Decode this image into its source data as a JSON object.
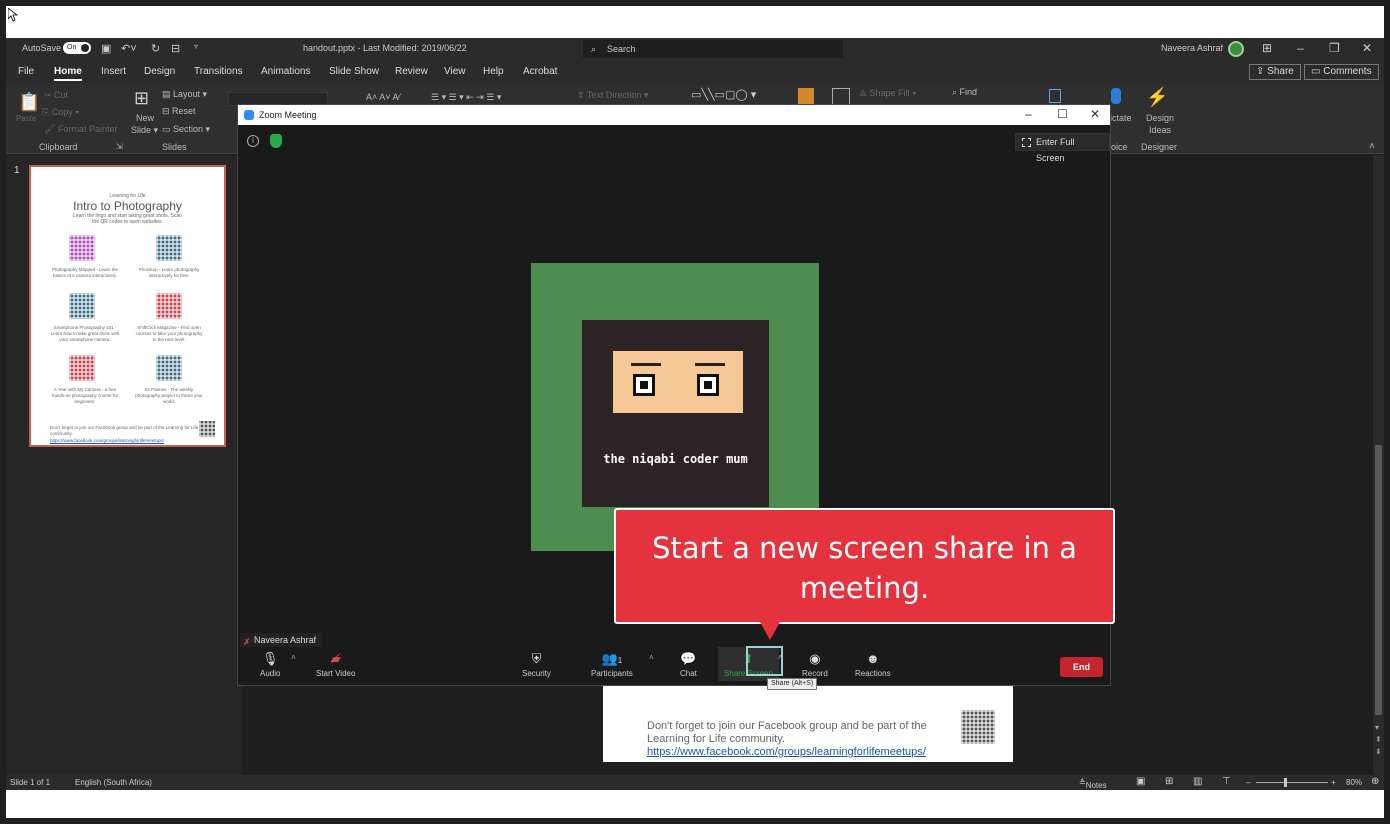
{
  "app": {
    "autosave_label": "AutoSave",
    "autosave_state": "On",
    "doc_title": "handout.pptx  -  Last Modified: 2019/06/22",
    "search_label": "Search",
    "user_name": "Naveera Ashraf"
  },
  "ribbon_tabs": [
    "File",
    "Home",
    "Insert",
    "Design",
    "Transitions",
    "Animations",
    "Slide Show",
    "Review",
    "View",
    "Help",
    "Acrobat"
  ],
  "ribbon_actions": {
    "share": "Share",
    "comments": "Comments"
  },
  "ribbon": {
    "paste": "Paste",
    "cut": "Cut",
    "copy": "Copy",
    "format_painter": "Format Painter",
    "clipboard_group": "Clipboard",
    "new_slide": "New",
    "new_slide_2": "Slide",
    "layout": "Layout",
    "reset": "Reset",
    "section": "Section",
    "slides_group": "Slides",
    "text_direction": "Text Direction",
    "shape_fill": "Shape Fill",
    "find": "Find",
    "dictate": "ictate",
    "voice_group": "oice",
    "design_ideas": "Design",
    "design_ideas_2": "Ideas",
    "designer_group": "Designer"
  },
  "thumbnail": {
    "slide_number": "1",
    "header_small": "Learning for Life",
    "header_big": "Intro to Photography",
    "subtitle": "Learn the lingo and start taking great shots. Scan the QR codes to open websites.",
    "items": [
      "Photography Mapped - Learn the basics of a camera interactively.",
      "Photokop - Learn photography interactively for free.",
      "Smartphone Photography 101 - Learn how to take great shots with your smartphone camera.",
      "ShiftClick Magazine - Find open courses to take your photography to the next level.",
      "A Year with My Camera - a free hands-on photography course for beginners.",
      "52 Frames - The weekly photography project to frame your world."
    ],
    "footer": "Don't forget to join our Facebook group and be part of the Learning for Life community.",
    "footer_link": "https://www.facebook.com/groups/learningforlifemeetups/"
  },
  "slide_fragment": {
    "text": "Don't forget to join our Facebook group and be part of the Learning for Life community.",
    "link": "https://www.facebook.com/groups/learningforlifemeetups/"
  },
  "status": {
    "slide_info": "Slide 1 of 1",
    "language": "English (South Africa)",
    "notes": "Notes",
    "zoom": "80%"
  },
  "zoom_window": {
    "title": "Zoom Meeting",
    "full_screen": "Enter Full Screen",
    "shared_text": "the niqabi coder mum",
    "participant": "Naveera Ashraf",
    "toolbar": {
      "audio": "Audio",
      "video": "Start Video",
      "security": "Security",
      "participants": "Participants",
      "participant_count": "1",
      "chat": "Chat",
      "share": "Share Screen",
      "record": "Record",
      "reactions": "Reactions",
      "end": "End"
    },
    "tooltip": "Share (Alt+S)"
  },
  "callout": {
    "text_line1": "Start a new screen share in a",
    "text_line2": "meeting."
  },
  "colors": {
    "callout": "#e5323f",
    "green": "#4d8d4f",
    "end_button": "#c6242f",
    "share_green": "#2aa84a"
  }
}
